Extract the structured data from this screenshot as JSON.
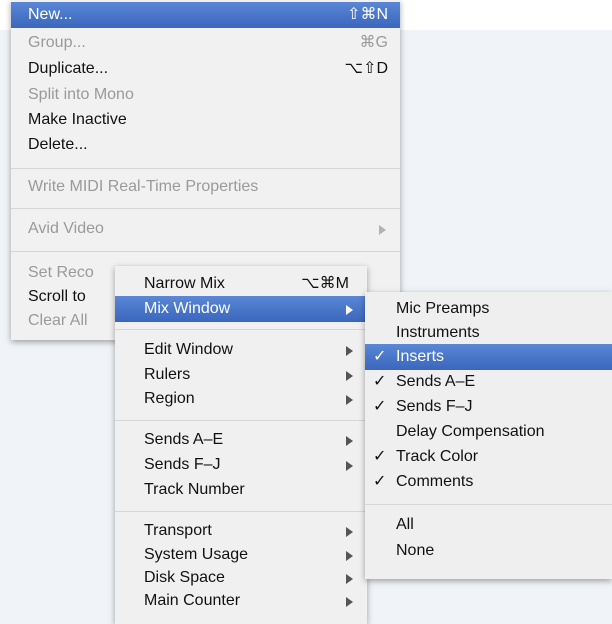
{
  "back_menu": {
    "items": [
      {
        "label": "New...",
        "shortcut": "⇧⌘N",
        "state": "highlighted"
      },
      {
        "label": "Group...",
        "shortcut": "⌘G",
        "state": "disabled"
      },
      {
        "label": "Duplicate...",
        "shortcut": "⌥⇧D",
        "state": "enabled"
      },
      {
        "label": "Split into Mono",
        "shortcut": "",
        "state": "disabled"
      },
      {
        "label": "Make Inactive",
        "shortcut": "",
        "state": "enabled"
      },
      {
        "label": "Delete...",
        "shortcut": "",
        "state": "enabled"
      },
      {
        "label": "Write MIDI Real-Time Properties",
        "shortcut": "",
        "state": "disabled"
      },
      {
        "label": "Avid Video",
        "shortcut": "",
        "state": "disabled"
      },
      {
        "label": "Set Reco",
        "shortcut": "",
        "state": "disabled"
      },
      {
        "label": "Scroll to",
        "shortcut": "",
        "state": "enabled"
      },
      {
        "label": "Clear All",
        "shortcut": "",
        "state": "disabled"
      }
    ]
  },
  "view_menu": {
    "items": [
      {
        "label": "Narrow Mix",
        "shortcut": "⌥⌘M"
      },
      {
        "label": "Mix Window"
      },
      {
        "label": "Edit Window"
      },
      {
        "label": "Rulers"
      },
      {
        "label": "Region"
      },
      {
        "label": "Sends A–E"
      },
      {
        "label": "Sends F–J"
      },
      {
        "label": "Track Number"
      },
      {
        "label": "Transport"
      },
      {
        "label": "System Usage"
      },
      {
        "label": "Disk Space"
      },
      {
        "label": "Main Counter"
      }
    ]
  },
  "mix_window_submenu": {
    "check_glyph": "✓",
    "items": [
      {
        "label": "Mic Preamps",
        "checked": false
      },
      {
        "label": "Instruments",
        "checked": false
      },
      {
        "label": "Inserts",
        "checked": true
      },
      {
        "label": "Sends A–E",
        "checked": true
      },
      {
        "label": "Sends F–J",
        "checked": true
      },
      {
        "label": "Delay Compensation",
        "checked": false
      },
      {
        "label": "Track Color",
        "checked": true
      },
      {
        "label": "Comments",
        "checked": true
      },
      {
        "label": "All",
        "checked": false
      },
      {
        "label": "None",
        "checked": false
      }
    ]
  },
  "colors": {
    "highlight_top": "#5b87d6",
    "highlight_bottom": "#3a66bd",
    "disabled_text": "#9a9a9a",
    "menu_bg": "#f1f1f1"
  }
}
